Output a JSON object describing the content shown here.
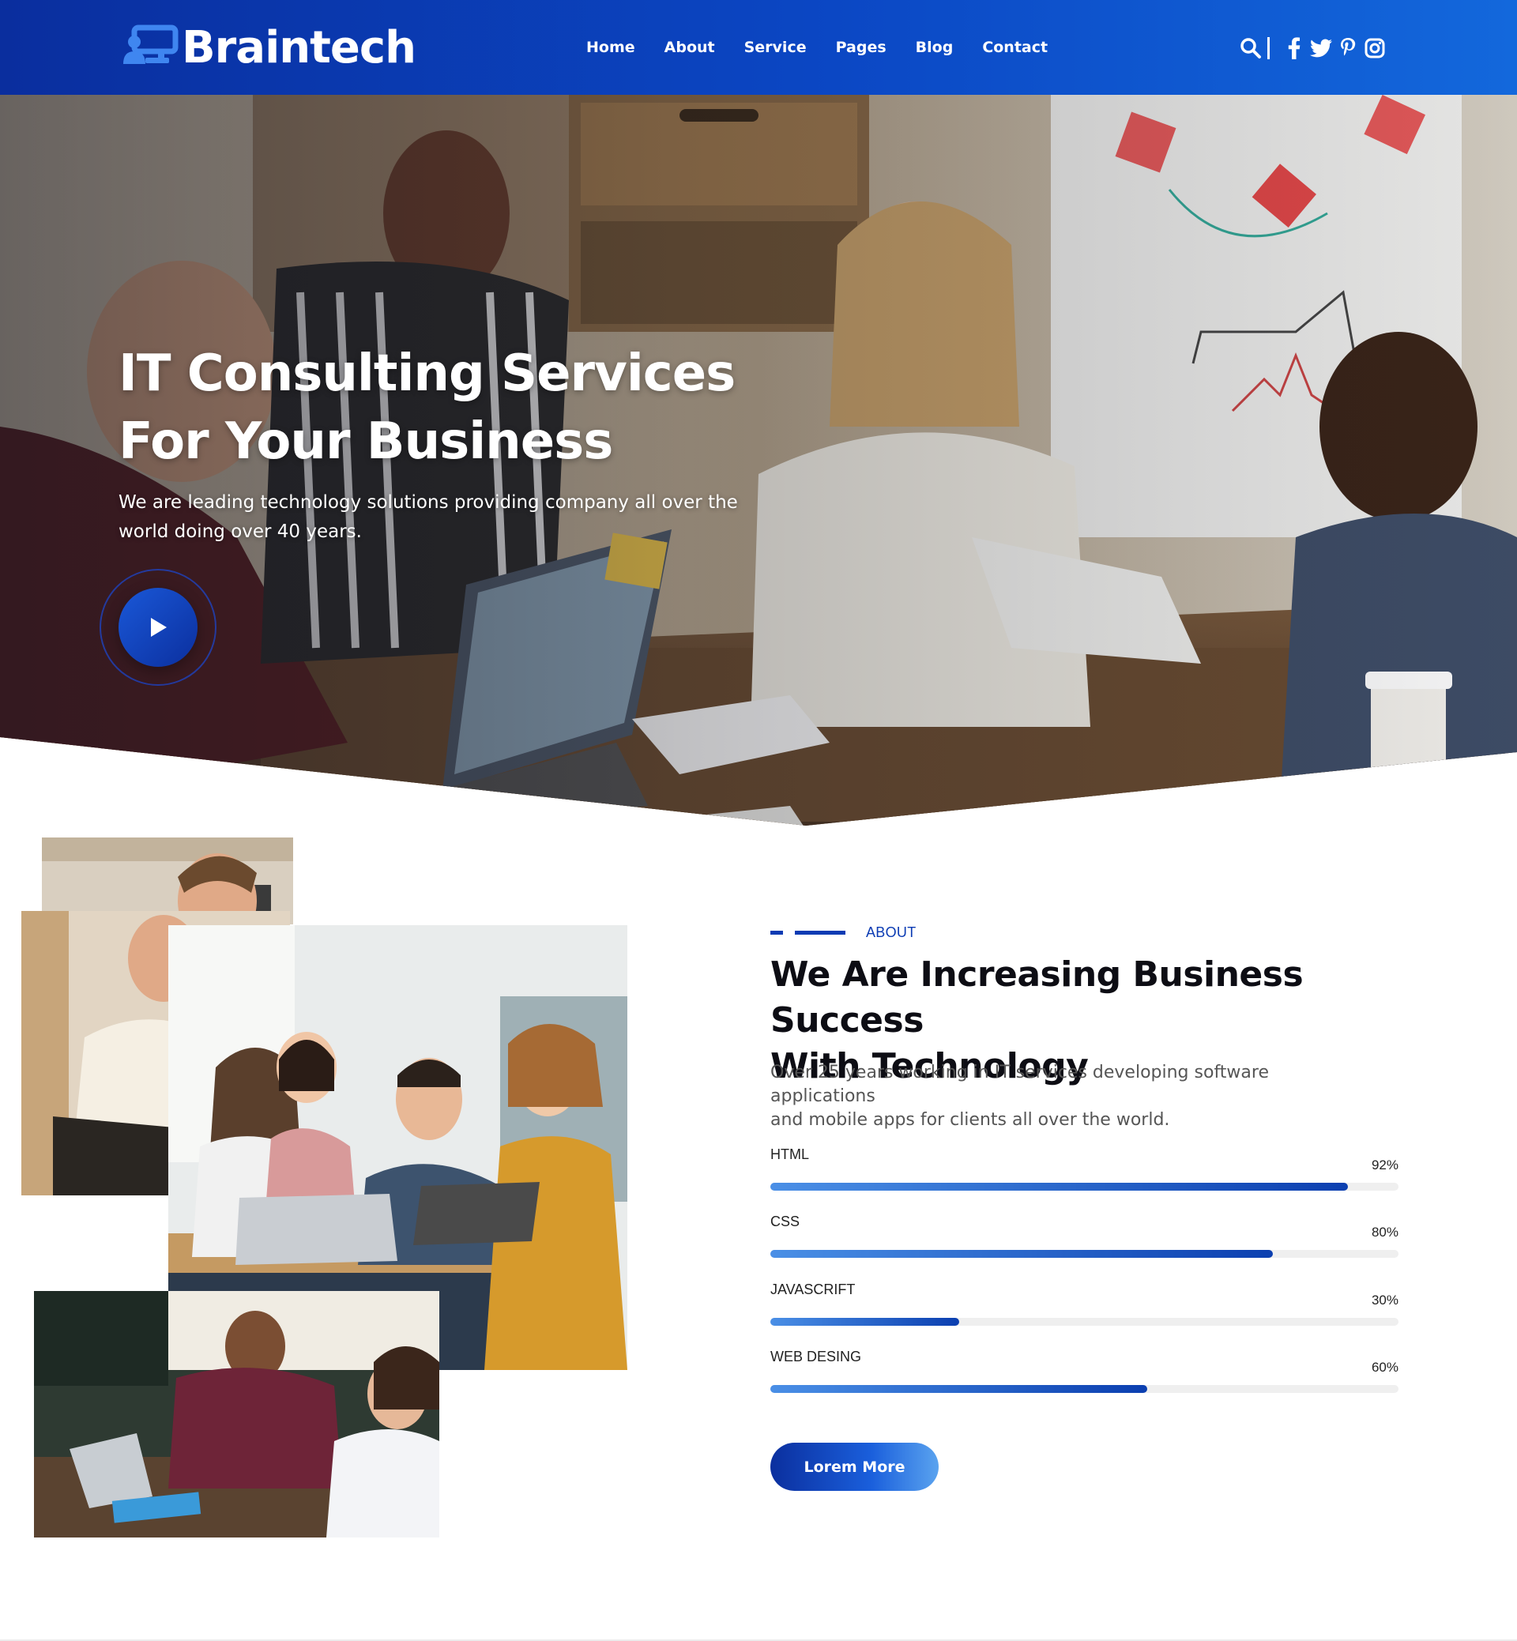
{
  "brand": {
    "name": "Braintech",
    "primary_color": "#0b3bb3",
    "accent_color": "#1a5fdc"
  },
  "nav": {
    "items": [
      {
        "label": "Home"
      },
      {
        "label": "About"
      },
      {
        "label": "Service"
      },
      {
        "label": "Pages"
      },
      {
        "label": "Blog"
      },
      {
        "label": "Contact"
      }
    ]
  },
  "header_tools": {
    "icons": [
      "search-icon",
      "facebook-icon",
      "twitter-icon",
      "pinterest-icon",
      "instagram-icon"
    ]
  },
  "hero": {
    "title_line1": "IT Consulting Services",
    "title_line2": "For Your Business",
    "subtitle_line1": "We are leading technology solutions providing company all over the",
    "subtitle_line2": "world doing over 40 years.",
    "play_icon": "play-icon"
  },
  "about": {
    "tag": "ABOUT",
    "title_line1": "We Are Increasing Business Success",
    "title_line2": "With Technology",
    "desc_line1": "Over 25 years working in IT services developing software applications",
    "desc_line2": "and mobile apps for clients all over the world.",
    "skills": [
      {
        "label": "HTML",
        "percent": 92,
        "percent_text": "92%"
      },
      {
        "label": "CSS",
        "percent": 80,
        "percent_text": "80%"
      },
      {
        "label": "JAVASCRIFT",
        "percent": 30,
        "percent_text": "30%"
      },
      {
        "label": "WEB DESING",
        "percent": 60,
        "percent_text": "60%"
      }
    ],
    "button_label": "Lorem More"
  }
}
